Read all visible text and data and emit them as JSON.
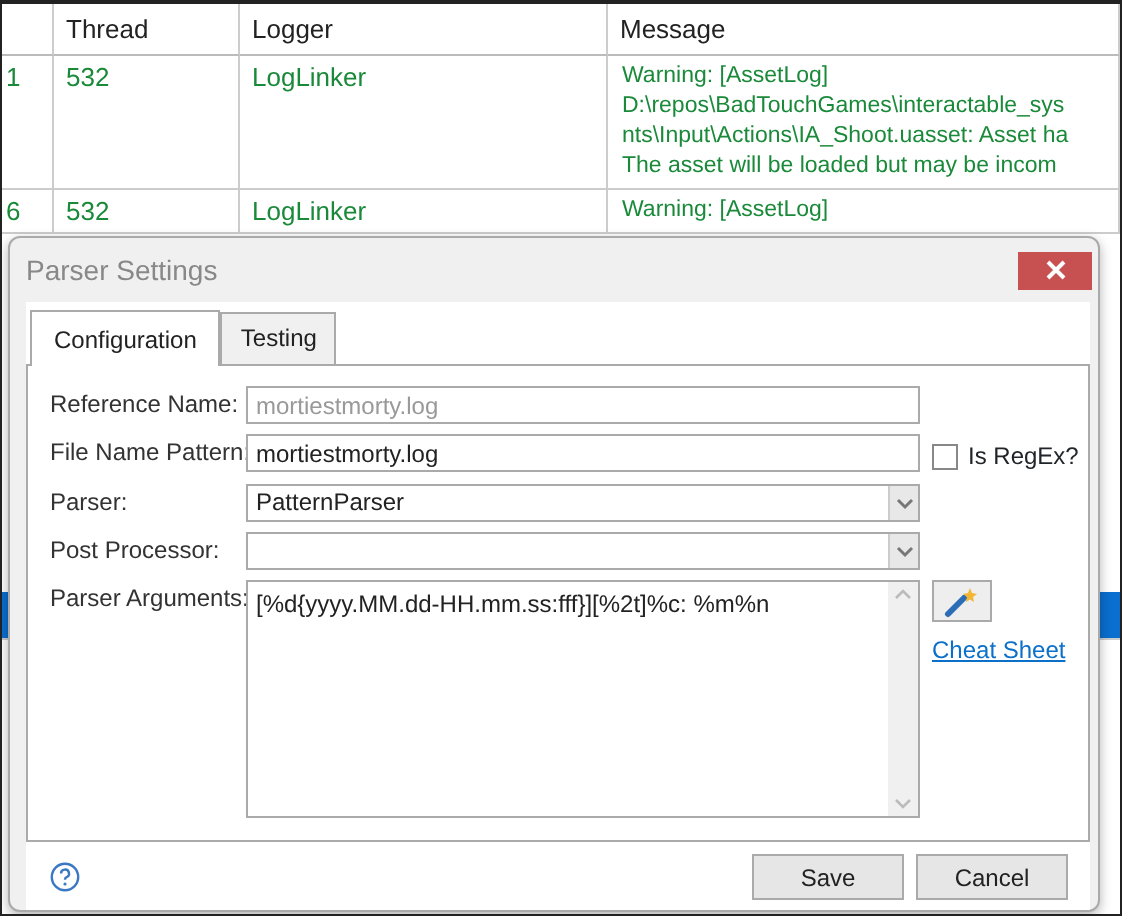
{
  "log_table": {
    "columns": [
      "Thread",
      "Logger",
      "Message"
    ],
    "rows": [
      {
        "id": "1",
        "thread": "532",
        "logger": "LogLinker",
        "message_lines": [
          "Warning: [AssetLog]",
          "D:\\repos\\BadTouchGames\\interactable_sys",
          "nts\\Input\\Actions\\IA_Shoot.uasset: Asset ha",
          "The asset will be loaded but may be incom"
        ],
        "selected": false
      },
      {
        "id": "6",
        "thread": "532",
        "logger": "LogLinker",
        "message_lines": [
          "Warning: [AssetLog]"
        ],
        "selected": false
      },
      {
        "selected": true
      }
    ]
  },
  "dialog": {
    "title": "Parser Settings",
    "tabs": [
      {
        "label": "Configuration",
        "selected": true
      },
      {
        "label": "Testing",
        "selected": false
      }
    ],
    "fields": [
      {
        "kind": "text",
        "label": "Reference Name:",
        "value": "mortiestmorty.log",
        "disabled": true
      },
      {
        "kind": "text",
        "label": "File Name Pattern:",
        "value": "mortiestmorty.log",
        "disabled": false,
        "checkbox": {
          "label": "Is RegEx?",
          "checked": false
        }
      },
      {
        "kind": "select",
        "label": "Parser:",
        "value": "PatternParser"
      },
      {
        "kind": "select",
        "label": "Post Processor:"
      },
      {
        "kind": "textarea",
        "label": "Parser Arguments:",
        "value": "[%d{yyyy.MM.dd-HH.mm.ss:fff}][%2t]%c: %m%n",
        "link": "Cheat Sheet"
      }
    ],
    "buttons": [
      "Save",
      "Cancel"
    ]
  }
}
